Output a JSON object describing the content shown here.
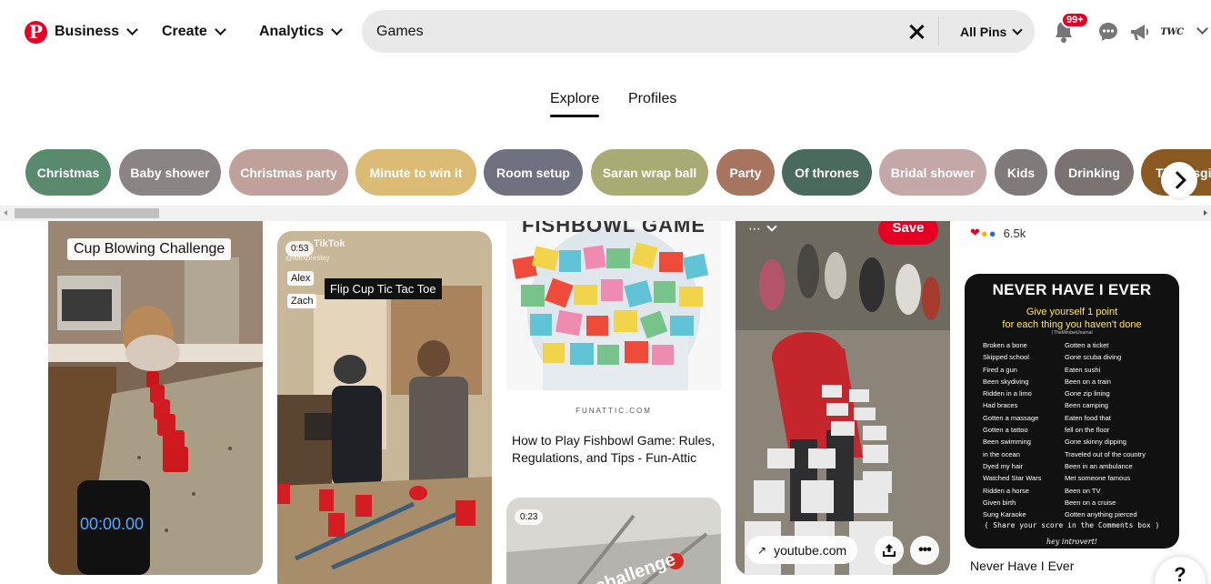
{
  "nav": {
    "business_label": "Business",
    "create_label": "Create",
    "analytics_label": "Analytics"
  },
  "search": {
    "value": "Games",
    "filter_label": "All Pins"
  },
  "notifications": {
    "badge": "99+"
  },
  "account": {
    "avatar_text": "TWC"
  },
  "tabs": [
    {
      "label": "Explore",
      "active": true
    },
    {
      "label": "Profiles",
      "active": false
    }
  ],
  "chips": [
    {
      "label": "Christmas",
      "color": "#5a8a6e"
    },
    {
      "label": "Baby shower",
      "color": "#8a8584"
    },
    {
      "label": "Christmas party",
      "color": "#bfa09a"
    },
    {
      "label": "Minute to win it",
      "color": "#dcbb74"
    },
    {
      "label": "Room setup",
      "color": "#6f7080"
    },
    {
      "label": "Saran wrap ball",
      "color": "#a8ab72"
    },
    {
      "label": "Party",
      "color": "#a7745f"
    },
    {
      "label": "Of thrones",
      "color": "#4b6a5e"
    },
    {
      "label": "Bridal shower",
      "color": "#c4a7a7"
    },
    {
      "label": "Kids",
      "color": "#817a7a"
    },
    {
      "label": "Drinking",
      "color": "#7b7272"
    },
    {
      "label": "Thanksgiving",
      "color": "#8a5a22"
    }
  ],
  "pins": {
    "cup_blowing": {
      "label": "Cup Blowing Challenge",
      "stopwatch": "00:00.00"
    },
    "flip_cup": {
      "time": "0:53",
      "tiktok": "TikTok",
      "handle": "@alexpresley",
      "tags": [
        "Alex",
        "Zach"
      ],
      "label": "Flip Cup Tic Tac Toe"
    },
    "fishbowl": {
      "header": "FISHBOWL GAME",
      "site_mark": "FUNATTIC.COM",
      "title": "How to Play Fishbowl Game: Rules, Regulations, and Tips - Fun-Attic"
    },
    "challenge": {
      "time": "0:23",
      "overlay": "challenge"
    },
    "hopscotch": {
      "save_label": "Save",
      "link_label": "youtube.com"
    },
    "reactions": {
      "count": "6.5k"
    },
    "never_have_i_ever": {
      "heading": "NEVER HAVE I EVER",
      "sub1": "Give yourself 1 point",
      "sub2": "for each thing you haven't done",
      "credit": "| TheMindsetJournal",
      "left_items": [
        "Broken a bone",
        "Skipped school",
        "Fired a gun",
        "Been skydiving",
        "Ridden in a limo",
        "Had braces",
        "Gotten a massage",
        "Gotten a tattoo",
        "Been swimming",
        "in the ocean",
        "Dyed my hair",
        "Watched Star Wars",
        "Ridden a horse",
        "Given birth",
        "Sung Karaoke"
      ],
      "right_items": [
        "Gotten a ticket",
        "Gone scuba diving",
        "Eaten sushi",
        "Been on a train",
        "Gone zip lining",
        "Been camping",
        "Eaten food that",
        "fell on the floor",
        "Gone skinny dipping",
        "Traveled out of the country",
        "Been in an ambulance",
        "Met someone famous",
        "Been on TV",
        "Been on a cruise",
        "Gotten anything pierced"
      ],
      "footer": "( Share your score in the Comments box )",
      "signature": "hey introvert!",
      "title": "Never Have I Ever"
    }
  },
  "help": {
    "label": "?"
  }
}
